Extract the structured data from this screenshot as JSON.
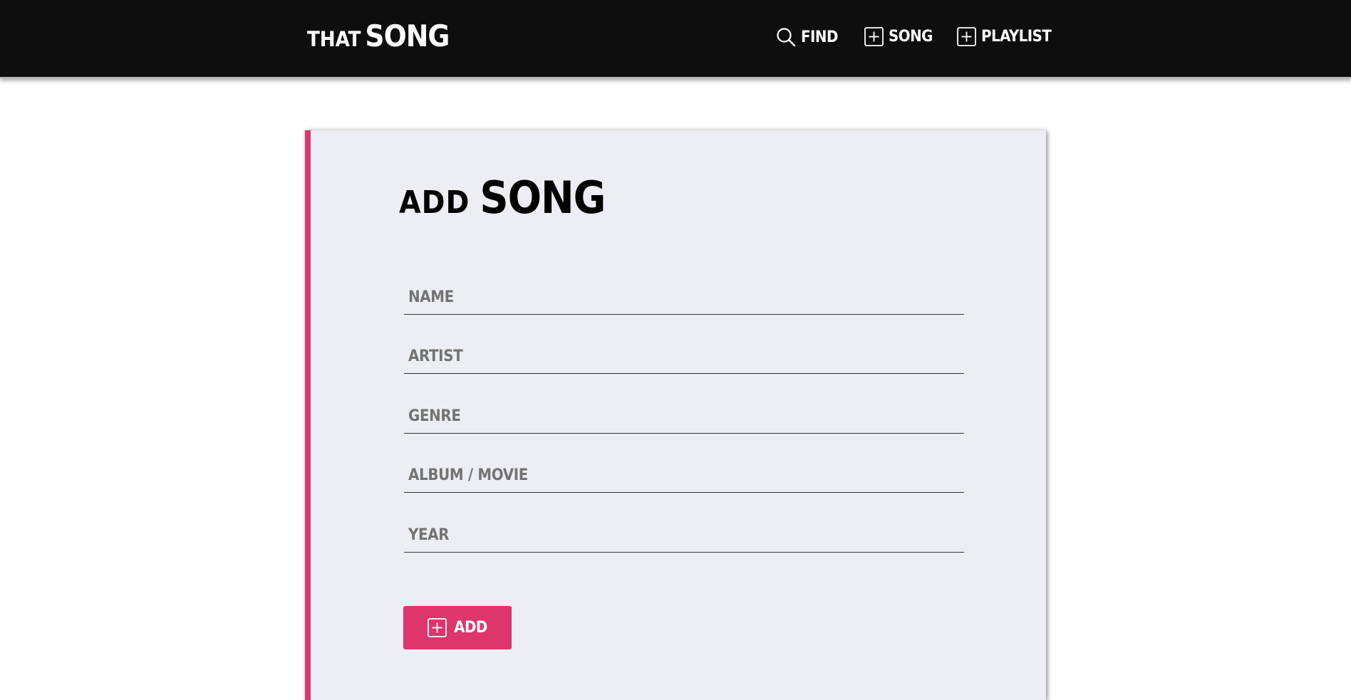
{
  "header": {
    "brand_small": "THAT",
    "brand_large": "SONG",
    "nav": {
      "find": {
        "label": "FIND",
        "icon": "search-icon"
      },
      "song": {
        "label": "SONG",
        "icon": "plus-square-icon"
      },
      "playlist": {
        "label": "PLAYLIST",
        "icon": "plus-square-icon"
      }
    }
  },
  "form": {
    "title_small": "ADD",
    "title_large": "SONG",
    "fields": {
      "name": {
        "placeholder": "NAME",
        "value": ""
      },
      "artist": {
        "placeholder": "ARTIST",
        "value": ""
      },
      "genre": {
        "placeholder": "GENRE",
        "value": ""
      },
      "album": {
        "placeholder": "ALBUM / MOVIE",
        "value": ""
      },
      "year": {
        "placeholder": "YEAR",
        "value": ""
      }
    },
    "submit_label": "ADD",
    "submit_icon": "plus-square-icon"
  },
  "colors": {
    "header_bg": "#0e0e0e",
    "accent": "#de356d",
    "card_bg": "#edeef3",
    "text_dark": "#000000",
    "placeholder": "#737373"
  }
}
